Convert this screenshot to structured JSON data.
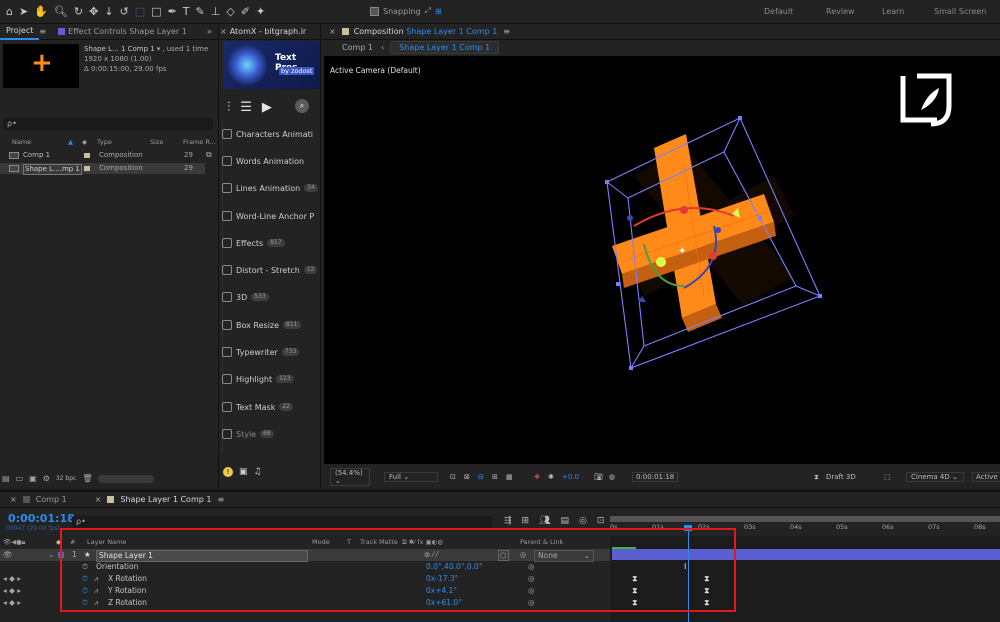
{
  "toolbar": {
    "snapping_label": "Snapping",
    "workspaces": [
      "Default",
      "Review",
      "Learn",
      "Small Screen"
    ]
  },
  "project_panel": {
    "tab_project": "Project",
    "tab_effect_controls": "Effect Controls Shape Layer 1",
    "comp_name": "Shape L... 1 Comp 1",
    "used_text": ", used 1 time",
    "resolution": "1920 x 1080 (1.00)",
    "duration": "Δ 0:00:15:00, 29.00 fps",
    "search_placeholder": "ρ•",
    "columns": [
      "Name",
      "Type",
      "Size",
      "Frame R..."
    ],
    "items": [
      {
        "name": "Comp 1",
        "type": "Composition",
        "fps": "29"
      },
      {
        "name": "Shape L....mp 1",
        "type": "Composition",
        "fps": "29"
      }
    ],
    "bpc": "32 bpc"
  },
  "atomx": {
    "tab": "AtomX - bitgraph.ir",
    "banner_title": "Text Pres",
    "banner_sub": "by zodost",
    "items": [
      {
        "label": "Characters Animati",
        "count": ""
      },
      {
        "label": "Words Animation",
        "count": ""
      },
      {
        "label": "Lines Animation",
        "count": "34"
      },
      {
        "label": "Word-Line Anchor P",
        "count": ""
      },
      {
        "label": "Effects",
        "count": "817"
      },
      {
        "label": "Distort - Stretch",
        "count": "12"
      },
      {
        "label": "3D",
        "count": "533"
      },
      {
        "label": "Box Resize",
        "count": "811"
      },
      {
        "label": "Typewriter",
        "count": "733"
      },
      {
        "label": "Highlight",
        "count": "123"
      },
      {
        "label": "Text Mask",
        "count": "22"
      },
      {
        "label": "Style",
        "count": "68"
      }
    ]
  },
  "composition": {
    "tab_label": "Composition",
    "tab_comp": "Shape Layer 1 Comp 1",
    "breadcrumb_1": "Comp 1",
    "breadcrumb_2": "Shape Layer 1 Comp 1",
    "camera": "Active Camera (Default)",
    "zoom": "(54.4%)",
    "resolution": "Full",
    "exposure": "+0.0",
    "timecode": "0:00:01:18",
    "draft": "Draft 3D",
    "renderer": "Cinema 4D",
    "active": "Active C"
  },
  "timeline": {
    "tab_comp1": "Comp 1",
    "tab_shape": "Shape Layer 1 Comp 1",
    "current_time": "0:00:01:18",
    "frame_info": "00047 (29.00 fps)",
    "columns": {
      "layer_name": "Layer Name",
      "mode": "Mode",
      "t": "T",
      "track_matte": "Track Matte",
      "parent": "Parent & Link"
    },
    "layer": {
      "num": "1",
      "name": "Shape Layer 1",
      "parent": "None"
    },
    "props": [
      {
        "name": "Orientation",
        "value": "0.0°,40.0°,0.0°"
      },
      {
        "name": "X Rotation",
        "value": "0x-17.3°"
      },
      {
        "name": "Y Rotation",
        "value": "0x+4.1°"
      },
      {
        "name": "Z Rotation",
        "value": "0x+61.0°"
      }
    ],
    "ruler": [
      "0s",
      "01s",
      "02s",
      "03s",
      "04s",
      "05s",
      "06s",
      "07s",
      "08s"
    ]
  }
}
